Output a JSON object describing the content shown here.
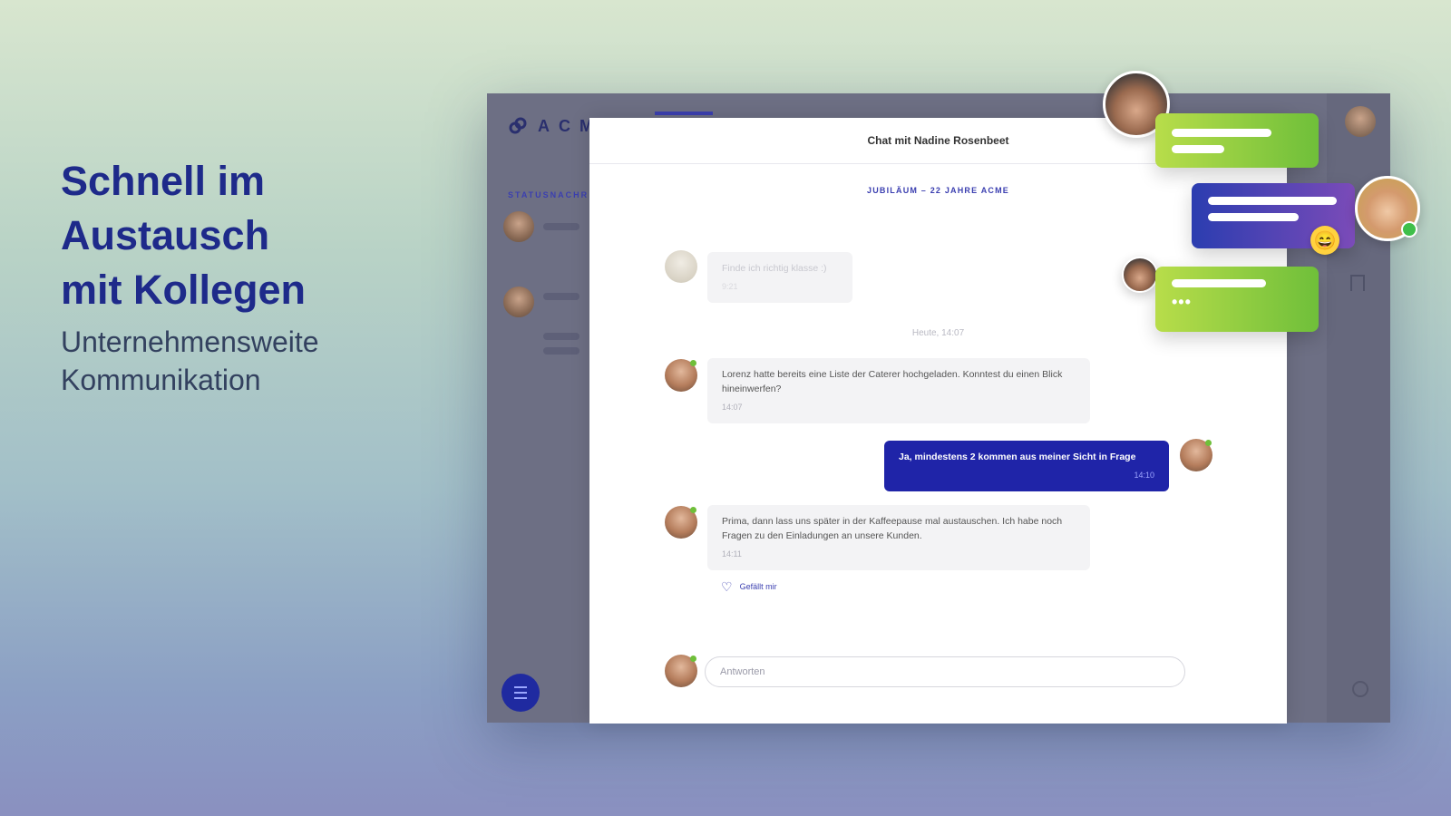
{
  "hero": {
    "title": "Schnell im\nAustausch\nmit Kollegen",
    "subtitle": "Unternehmensweite\nKommunikation"
  },
  "app": {
    "logo_text": "ACM",
    "section_label": "STATUSNACHR",
    "accent_color": "#1f24a8"
  },
  "chat": {
    "header_title": "Chat mit Nadine Rosenbeet",
    "topic": "JUBILÄUM – 22 JAHRE ACME",
    "day_label": "Heute, 14:07",
    "messages": [
      {
        "text": "Finde ich richtig klasse :)",
        "time": "9:21",
        "from": "other",
        "faded": true
      },
      {
        "text": "Lorenz hatte bereits eine Liste der Caterer hochgeladen. Konntest du einen Blick hineinwerfen?",
        "time": "14:07",
        "from": "other"
      },
      {
        "text": "Ja, mindestens 2 kommen aus meiner Sicht in Frage",
        "time": "14:10",
        "from": "me"
      },
      {
        "text": "Prima, dann lass uns später in der Kaffeepause mal austauschen. Ich habe noch Fragen zu den Einladungen an unsere Kunden.",
        "time": "14:11",
        "from": "other"
      }
    ],
    "like_label": "Gefällt mir",
    "input_placeholder": "Antworten"
  },
  "decor": {
    "emoji": "😄",
    "typing": "•••",
    "green": "#6fbf3a",
    "blue": "#2b3db0"
  }
}
